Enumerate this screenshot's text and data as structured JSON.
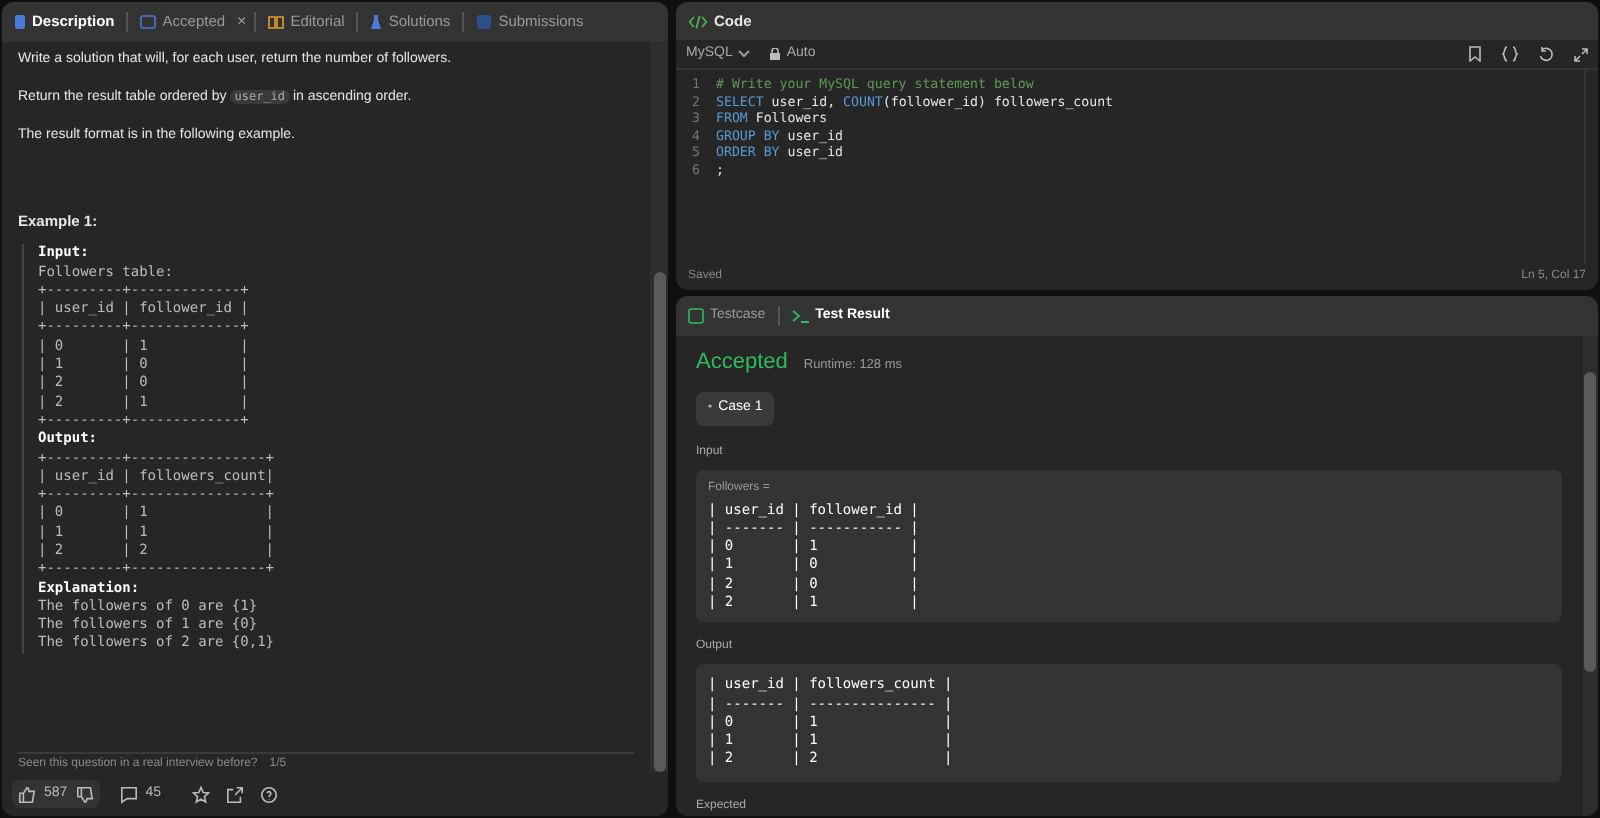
{
  "left_panel": {
    "tabs": [
      {
        "label": "Description",
        "selected": true
      },
      {
        "label": "Accepted",
        "selected": false,
        "close": "×"
      },
      {
        "label": "Editorial",
        "selected": false
      },
      {
        "label": "Solutions",
        "selected": false
      },
      {
        "label": "Submissions",
        "selected": false
      }
    ],
    "paragraphs": [
      {
        "before": "Write a solution that will, for each user, return the number of followers."
      },
      {
        "before": "Return the result table ordered by",
        "code": "user_id",
        "after": "in ascending order."
      },
      {
        "before": "The result format is in the following example."
      }
    ],
    "example_title": "Example 1:",
    "example_lines": [
      {
        "kind": "heading",
        "text": "Input:"
      },
      {
        "kind": "line",
        "text": "Followers table:"
      },
      {
        "kind": "line",
        "text": "+---------+-------------+"
      },
      {
        "kind": "line",
        "text": "| user_id | follower_id |"
      },
      {
        "kind": "line",
        "text": "+---------+-------------+"
      },
      {
        "kind": "line",
        "text": "| 0       | 1           |"
      },
      {
        "kind": "line",
        "text": "| 1       | 0           |"
      },
      {
        "kind": "line",
        "text": "| 2       | 0           |"
      },
      {
        "kind": "line",
        "text": "| 2       | 1           |"
      },
      {
        "kind": "line",
        "text": "+---------+-------------+"
      },
      {
        "kind": "heading",
        "text": "Output:"
      },
      {
        "kind": "line",
        "text": "+---------+----------------+"
      },
      {
        "kind": "line",
        "text": "| user_id | followers_count|"
      },
      {
        "kind": "line",
        "text": "+---------+----------------+"
      },
      {
        "kind": "line",
        "text": "| 0       | 1              |"
      },
      {
        "kind": "line",
        "text": "| 1       | 1              |"
      },
      {
        "kind": "line",
        "text": "| 2       | 2              |"
      },
      {
        "kind": "line",
        "text": "+---------+----------------+"
      },
      {
        "kind": "heading",
        "text": "Explanation:"
      },
      {
        "kind": "line",
        "text": "The followers of 0 are {1}"
      },
      {
        "kind": "line",
        "text": "The followers of 1 are {0}"
      },
      {
        "kind": "line",
        "text": "The followers of 2 are {0,1}"
      }
    ],
    "interview_prompt": "Seen this question in a real interview before?",
    "interview_count": "1/5",
    "footer": {
      "likes": "587",
      "comments": "45"
    }
  },
  "code_panel": {
    "title": "Code",
    "language": "MySQL",
    "mode": "Auto",
    "lines": [
      {
        "number": "1",
        "tokens": [
          {
            "kind": "comment",
            "text": "# Write your MySQL query statement below"
          }
        ]
      },
      {
        "number": "2",
        "tokens": [
          {
            "kind": "keyword",
            "text": "SELECT"
          },
          {
            "kind": "plain",
            "text": " user_id, "
          },
          {
            "kind": "keyword",
            "text": "COUNT"
          },
          {
            "kind": "plain",
            "text": "(follower_id) followers_count"
          }
        ]
      },
      {
        "number": "3",
        "tokens": [
          {
            "kind": "keyword",
            "text": "FROM"
          },
          {
            "kind": "plain",
            "text": " Followers"
          }
        ]
      },
      {
        "number": "4",
        "tokens": [
          {
            "kind": "keyword",
            "text": "GROUP BY"
          },
          {
            "kind": "plain",
            "text": " user_id"
          }
        ]
      },
      {
        "number": "5",
        "tokens": [
          {
            "kind": "keyword",
            "text": "ORDER BY"
          },
          {
            "kind": "plain",
            "text": " user_id"
          }
        ]
      },
      {
        "number": "6",
        "tokens": [
          {
            "kind": "plain",
            "text": ";"
          }
        ]
      }
    ],
    "status": "Saved",
    "cursor": "Ln 5, Col 17"
  },
  "result_panel": {
    "tabs": [
      {
        "label": "Testcase",
        "selected": false
      },
      {
        "label": "Test Result",
        "selected": true
      }
    ],
    "verdict": "Accepted",
    "runtime": "Runtime: 128 ms",
    "case": {
      "label": "Case 1",
      "marker": "•"
    },
    "input_label": "Input",
    "input_name": "Followers =",
    "input_lines": [
      "| user_id | follower_id |",
      "| ------- | ----------- |",
      "| 0       | 1           |",
      "| 1       | 0           |",
      "| 2       | 0           |",
      "| 2       | 1           |"
    ],
    "output_label": "Output",
    "output_lines": [
      "| user_id | followers_count |",
      "| ------- | --------------- |",
      "| 0       | 1               |",
      "| 1       | 1               |",
      "| 2       | 2               |"
    ],
    "expected_label": "Expected"
  }
}
